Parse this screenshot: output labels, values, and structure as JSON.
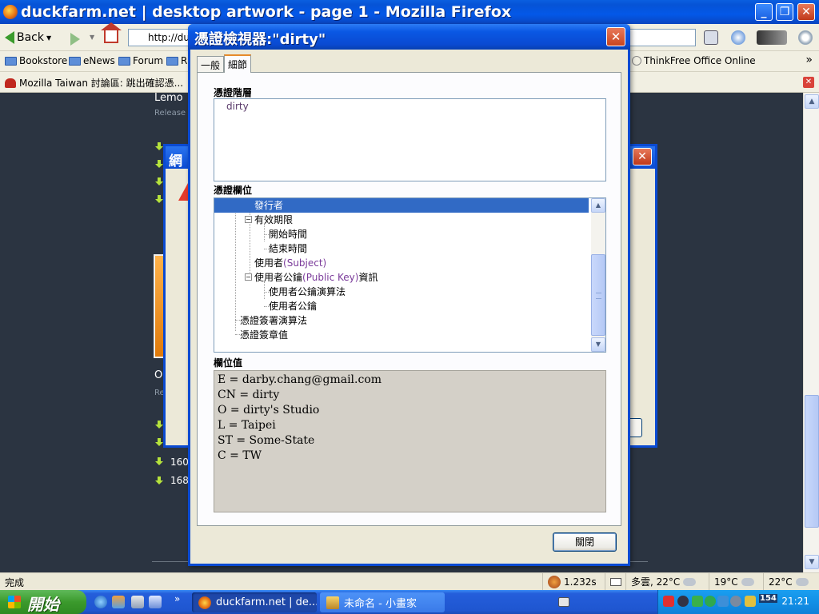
{
  "browser": {
    "title": "duckfarm.net | desktop artwork - page 1 - Mozilla Firefox",
    "back_label": "Back",
    "url": "http://du",
    "bookmarks": [
      "Bookstore",
      "eNews",
      "Forum",
      "R",
      "ThinkFree Office Online"
    ],
    "bookmarks_more": "»",
    "info_tab": "Mozilla Taiwan 討論區: 跳出確認憑..."
  },
  "page": {
    "heading1": "Lemo",
    "sub1": "Release",
    "heading2": "O",
    "sub2": "Re",
    "item_a": "160",
    "item_b": "168"
  },
  "bg_dialog": {
    "title": "網"
  },
  "cert_dialog": {
    "title": "憑證檢視器:\"dirty\"",
    "close_glyph": "✕",
    "tabs": [
      "一般",
      "細節"
    ],
    "hierarchy_label": "憑證階層",
    "hierarchy_items": [
      "dirty"
    ],
    "fields_label": "憑證欄位",
    "tree": [
      {
        "zh": "發行者",
        "en": "",
        "after": ""
      },
      {
        "zh": "有效期限",
        "en": "",
        "after": ""
      },
      {
        "zh": "開始時間",
        "en": "",
        "after": ""
      },
      {
        "zh": "結束時間",
        "en": "",
        "after": ""
      },
      {
        "zh": "使用者",
        "en": "(Subject)",
        "after": ""
      },
      {
        "zh": "使用者公鑰",
        "en": "(Public Key)",
        "after": "資訊"
      },
      {
        "zh": "使用者公鑰演算法",
        "en": "",
        "after": ""
      },
      {
        "zh": "使用者公鑰",
        "en": "",
        "after": ""
      },
      {
        "zh": "憑證簽署演算法",
        "en": "",
        "after": ""
      },
      {
        "zh": "憑證簽章值",
        "en": "",
        "after": ""
      }
    ],
    "value_label": "欄位值",
    "value_lines": [
      "E = darby.chang@gmail.com",
      "CN = dirty",
      "O = dirty's Studio",
      "L = Taipei",
      "ST = Some-State",
      "C = TW"
    ],
    "close_button": "關閉"
  },
  "statusbar": {
    "status": "完成",
    "timing": "1.232s",
    "weather1": "多雲, 22°C",
    "weather2": "19°C",
    "weather3": "22°C"
  },
  "taskbar": {
    "start": "開始",
    "tasks": [
      "duckfarm.net | de...",
      "未命名 - 小畫家"
    ],
    "tray_badge": "154",
    "clock": "21:21"
  }
}
